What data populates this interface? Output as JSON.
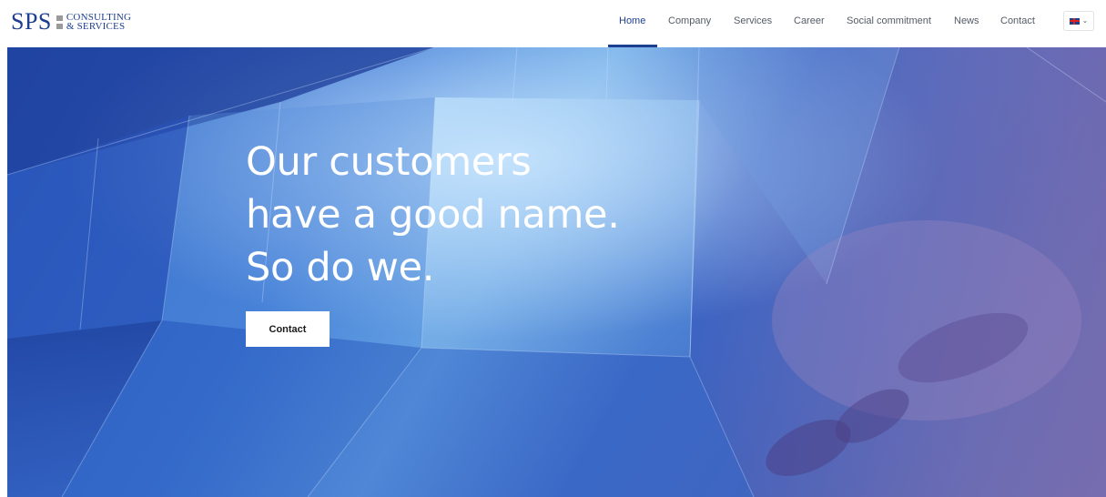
{
  "logo": {
    "mark": "SPS",
    "line1": "CONSULTING",
    "line2": "& SERVICES"
  },
  "nav": {
    "items": [
      {
        "label": "Home",
        "active": true
      },
      {
        "label": "Company",
        "active": false
      },
      {
        "label": "Services",
        "active": false
      },
      {
        "label": "Career",
        "active": false
      },
      {
        "label": "Social commitment",
        "active": false
      },
      {
        "label": "News",
        "active": false
      },
      {
        "label": "Contact",
        "active": false
      }
    ],
    "language_icon": "uk-flag-icon",
    "accent_color": "#1d3f8f"
  },
  "hero": {
    "headline": [
      "Our customers",
      "have a good name.",
      "So do we."
    ],
    "cta_label": "Contact",
    "background": "blue glass architecture with a hand"
  }
}
